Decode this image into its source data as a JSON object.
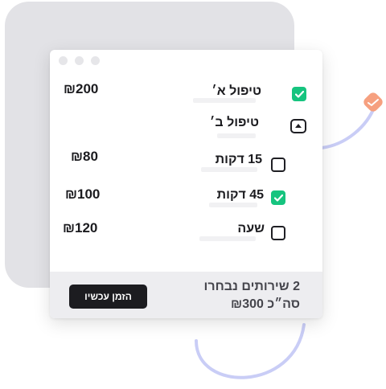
{
  "items": [
    {
      "label": "טיפול א׳",
      "price": "₪200",
      "checked": true
    },
    {
      "label": "טיפול ב׳",
      "expanded": true
    },
    {
      "label": "15 דקות",
      "price": "₪80",
      "checked": false
    },
    {
      "label": "45 דקות",
      "price": "₪100",
      "checked": true
    },
    {
      "label": "שעה",
      "price": "₪120",
      "checked": false
    }
  ],
  "footer": {
    "selected_count": "2 שירותים נבחרו",
    "total": "סה״כ ₪300",
    "button_label": "הזמן עכשיו"
  },
  "colors": {
    "accent_green": "#16c47f",
    "button_dark": "#1c1c20",
    "background_card": "#e2e2e6",
    "decorative_stroke": "#c9cdf6",
    "badge": "#f6a07f"
  }
}
